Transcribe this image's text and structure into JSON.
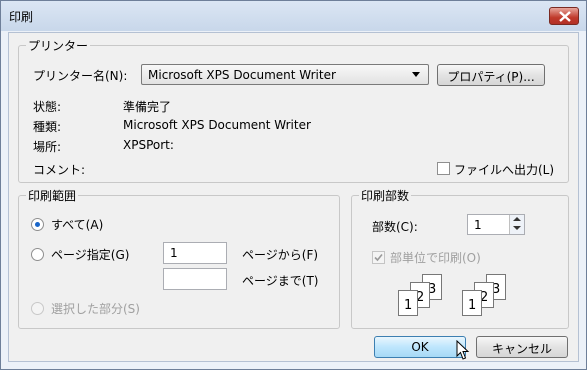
{
  "window": {
    "title": "印刷",
    "close_label": "×"
  },
  "printer_group": {
    "title": "プリンター",
    "name_label": "プリンター名(N):",
    "selected_printer": "Microsoft XPS Document Writer",
    "properties_button": "プロパティ(P)...",
    "status_label": "状態:",
    "status_value": "準備完了",
    "type_label": "種類:",
    "type_value": "Microsoft XPS Document Writer",
    "location_label": "場所:",
    "location_value": "XPSPort:",
    "comment_label": "コメント:",
    "print_to_file_label": "ファイルへ出力(L)",
    "print_to_file_checked": false
  },
  "range_group": {
    "title": "印刷範囲",
    "all_label": "すべて(A)",
    "all_selected": true,
    "pages_label": "ページ指定(G)",
    "from_value": "1",
    "from_label": "ページから(F)",
    "to_value": "",
    "to_label": "ページまで(T)",
    "selection_label": "選択した部分(S)"
  },
  "copies_group": {
    "title": "印刷部数",
    "copies_label": "部数(C):",
    "copies_value": "1",
    "collate_label": "部単位で印刷(O)",
    "collate_checked": true,
    "collate_stack_1": [
      "1",
      "2",
      "3"
    ],
    "collate_stack_2": [
      "1",
      "2",
      "3"
    ]
  },
  "buttons": {
    "ok": "OK",
    "cancel": "キャンセル"
  }
}
